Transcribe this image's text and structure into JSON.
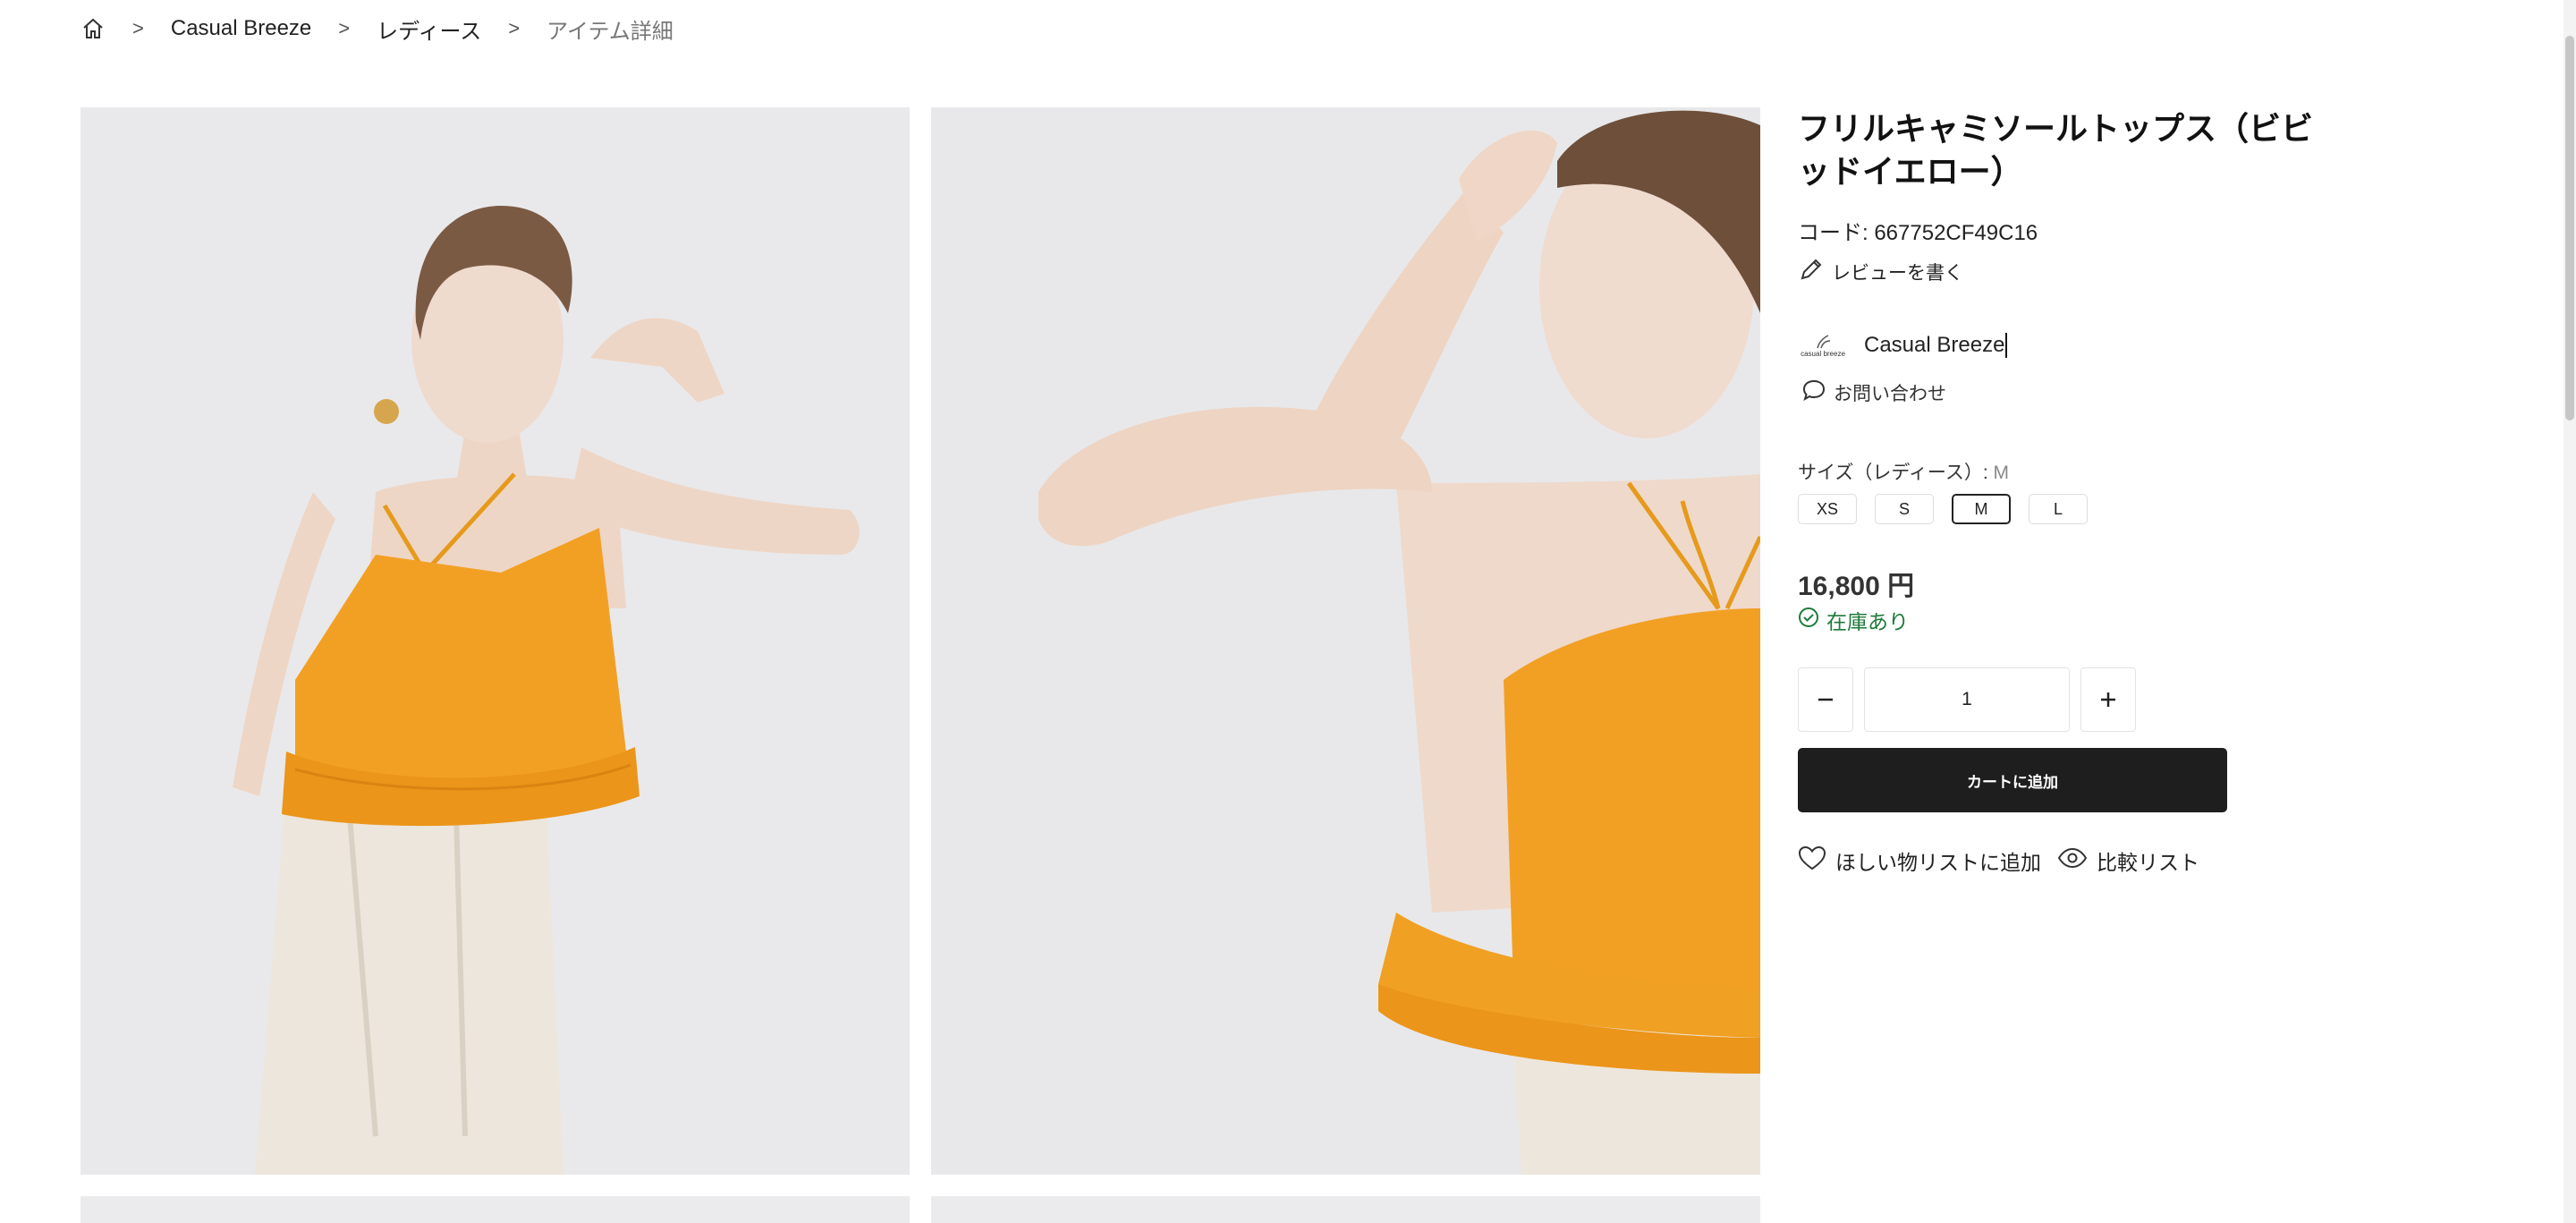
{
  "breadcrumb": {
    "items": [
      "Casual Breeze",
      "レディース",
      "アイテム詳細"
    ],
    "separator": ">"
  },
  "product": {
    "title": "フリルキャミソールトップス（ビビッドイエロー）",
    "code": "コード: 667752CF49C16",
    "review_label": "レビューを書く",
    "shop_name": "Casual Breeze",
    "shop_logo_text": "casual breeze",
    "inquiry_label": "お問い合わせ",
    "size_label": "サイズ（レディース）: ",
    "size_selected": "M",
    "sizes": [
      "XS",
      "S",
      "M",
      "L"
    ],
    "price": "16,800 円",
    "stock": "在庫あり",
    "quantity": "1",
    "add_to_cart": "カートに追加",
    "wishlist_label": "ほしい物リストに追加",
    "compare_label": "比較リスト"
  },
  "colors": {
    "accent_dark": "#1e1e1e",
    "stock_green": "#1f7a3a",
    "garment_orange": "#f2a024"
  },
  "icons": [
    "home-icon",
    "chevron-right-icon",
    "pencil-icon",
    "chat-bubble-icon",
    "check-circle-icon",
    "minus-icon",
    "plus-icon",
    "heart-icon",
    "eye-icon"
  ]
}
